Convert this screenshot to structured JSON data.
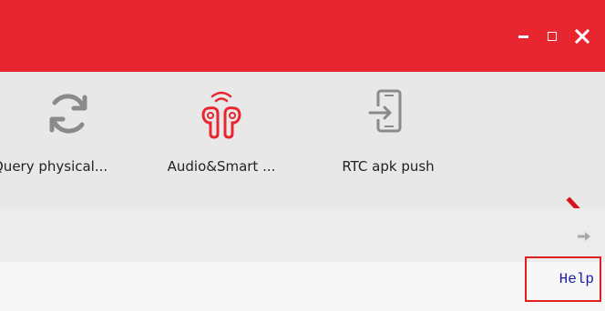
{
  "window": {
    "minimize_icon": "minimize-icon",
    "maximize_icon": "maximize-icon",
    "close_icon": "close-icon",
    "accent_color": "#e8262f"
  },
  "toolbar": {
    "items": [
      {
        "label": "Query physical...",
        "icon": "refresh-icon"
      },
      {
        "label": "Audio&Smart ...",
        "icon": "earbuds-icon"
      },
      {
        "label": "RTC apk push",
        "icon": "phone-push-icon"
      }
    ],
    "next_icon": "chevron-right-icon"
  },
  "subbar": {
    "arrow_icon": "arrow-right-icon"
  },
  "help": {
    "label": "Help"
  }
}
